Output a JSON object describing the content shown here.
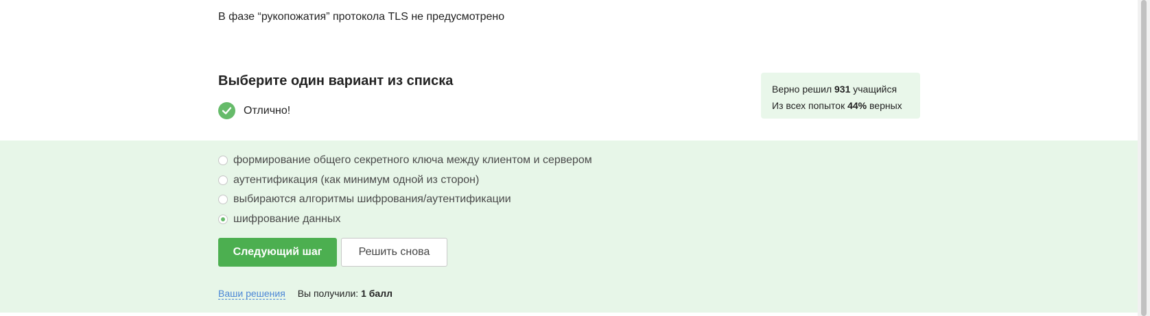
{
  "question": {
    "text": "В фазе “рукопожатия” протокола TLS не предусмотрено"
  },
  "quiz": {
    "heading": "Выберите один вариант из списка",
    "feedback": "Отлично!",
    "options": [
      {
        "label": "формирование общего секретного ключа между клиентом и сервером",
        "selected": false
      },
      {
        "label": "аутентификация (как минимум одной из сторон)",
        "selected": false
      },
      {
        "label": "выбираются алгоритмы шифрования/аутентификации",
        "selected": false
      },
      {
        "label": "шифрование данных",
        "selected": true
      }
    ]
  },
  "stats": {
    "line1_prefix": "Верно решил",
    "solvers_count": "931",
    "line1_suffix": "учащийся",
    "line2_prefix": "Из всех попыток",
    "correct_percent": "44%",
    "line2_suffix": "верных"
  },
  "actions": {
    "next_step_label": "Следующий шаг",
    "retry_label": "Решить снова"
  },
  "footer": {
    "solutions_link": "Ваши решения",
    "score_prefix": "Вы получили:",
    "score_value": "1 балл"
  },
  "colors": {
    "accent_green": "#4caf50",
    "answer_area_bg": "#e7f6e8",
    "link_blue": "#4a86d6"
  },
  "icons": {
    "feedback_icon": "checkmark-circle-icon"
  }
}
